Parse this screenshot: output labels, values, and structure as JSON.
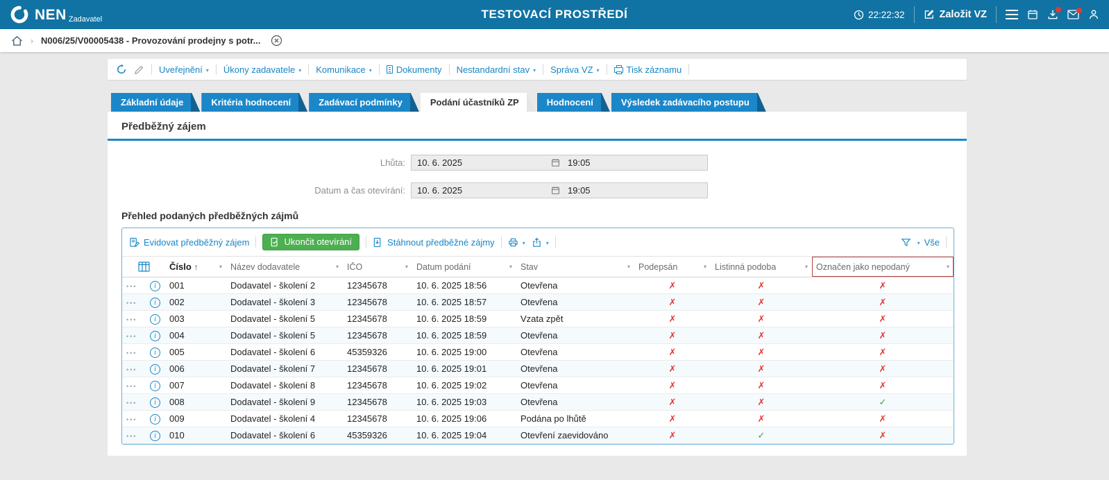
{
  "topbar": {
    "brand": "NEN",
    "brand_subtitle": "Zadavatel",
    "environment_title": "TESTOVACÍ PROSTŘEDÍ",
    "clock": "22:22:32",
    "create_vz_label": "Založit VZ"
  },
  "breadcrumb": {
    "record": "N006/25/V00005438 - Provozování prodejny s potr..."
  },
  "record_menubar": {
    "items": [
      {
        "label": "Uveřejnění",
        "caret": true
      },
      {
        "label": "Úkony zadavatele",
        "caret": true
      },
      {
        "label": "Komunikace",
        "caret": true
      },
      {
        "label": "Dokumenty",
        "icon": "document",
        "caret": false
      },
      {
        "label": "Nestandardní stav",
        "caret": true
      },
      {
        "label": "Správa VZ",
        "caret": true
      },
      {
        "label": "Tisk záznamu",
        "icon": "printer",
        "caret": false
      }
    ]
  },
  "tabs": [
    {
      "label": "Základní údaje",
      "active": false
    },
    {
      "label": "Kritéria hodnocení",
      "active": false
    },
    {
      "label": "Zadávací podmínky",
      "active": false
    },
    {
      "label": "Podání účastníků ZP",
      "active": true
    },
    {
      "label": "Hodnocení",
      "active": false
    },
    {
      "label": "Výsledek zadávacího postupu",
      "active": false
    }
  ],
  "section": {
    "title": "Předběžný zájem"
  },
  "form": {
    "rows": [
      {
        "label": "Lhůta:",
        "date": "10. 6. 2025",
        "time": "19:05"
      },
      {
        "label": "Datum a čas otevírání:",
        "date": "10. 6. 2025",
        "time": "19:05"
      }
    ]
  },
  "table": {
    "title": "Přehled podaných předběžných zájmů",
    "toolbar": {
      "evidovat": "Evidovat předběžný zájem",
      "ukoncit": "Ukončit otevírání",
      "stahnout": "Stáhnout předběžné zájmy",
      "vse": "Vše"
    },
    "columns": [
      {
        "label": "Číslo",
        "sorted": "asc"
      },
      {
        "label": "Název dodavatele"
      },
      {
        "label": "IČO"
      },
      {
        "label": "Datum podání"
      },
      {
        "label": "Stav"
      },
      {
        "label": "Podepsán"
      },
      {
        "label": "Listinná podoba"
      },
      {
        "label": "Označen jako nepodaný",
        "highlighted": true
      }
    ],
    "rows": [
      {
        "cislo": "001",
        "dodavatel": "Dodavatel - školení 2",
        "ico": "12345678",
        "datum": "10. 6. 2025 18:56",
        "stav": "Otevřena",
        "podepsan": false,
        "listinna": false,
        "nepodany": false
      },
      {
        "cislo": "002",
        "dodavatel": "Dodavatel - školení 3",
        "ico": "12345678",
        "datum": "10. 6. 2025 18:57",
        "stav": "Otevřena",
        "podepsan": false,
        "listinna": false,
        "nepodany": false
      },
      {
        "cislo": "003",
        "dodavatel": "Dodavatel - školení 5",
        "ico": "12345678",
        "datum": "10. 6. 2025 18:59",
        "stav": "Vzata zpět",
        "podepsan": false,
        "listinna": false,
        "nepodany": false
      },
      {
        "cislo": "004",
        "dodavatel": "Dodavatel - školení 5",
        "ico": "12345678",
        "datum": "10. 6. 2025 18:59",
        "stav": "Otevřena",
        "podepsan": false,
        "listinna": false,
        "nepodany": false
      },
      {
        "cislo": "005",
        "dodavatel": "Dodavatel - školení 6",
        "ico": "45359326",
        "datum": "10. 6. 2025 19:00",
        "stav": "Otevřena",
        "podepsan": false,
        "listinna": false,
        "nepodany": false
      },
      {
        "cislo": "006",
        "dodavatel": "Dodavatel - školení 7",
        "ico": "12345678",
        "datum": "10. 6. 2025 19:01",
        "stav": "Otevřena",
        "podepsan": false,
        "listinna": false,
        "nepodany": false
      },
      {
        "cislo": "007",
        "dodavatel": "Dodavatel - školení 8",
        "ico": "12345678",
        "datum": "10. 6. 2025 19:02",
        "stav": "Otevřena",
        "podepsan": false,
        "listinna": false,
        "nepodany": false
      },
      {
        "cislo": "008",
        "dodavatel": "Dodavatel - školení 9",
        "ico": "12345678",
        "datum": "10. 6. 2025 19:03",
        "stav": "Otevřena",
        "podepsan": false,
        "listinna": false,
        "nepodany": true
      },
      {
        "cislo": "009",
        "dodavatel": "Dodavatel - školení 4",
        "ico": "12345678",
        "datum": "10. 6. 2025 19:06",
        "stav": "Podána po lhůtě",
        "podepsan": false,
        "listinna": false,
        "nepodany": false
      },
      {
        "cislo": "010",
        "dodavatel": "Dodavatel - školení 6",
        "ico": "45359326",
        "datum": "10. 6. 2025 19:04",
        "stav": "Otevření zaevidováno",
        "podepsan": false,
        "listinna": true,
        "nepodany": false
      }
    ]
  },
  "icons": {
    "caret": "▾",
    "sort_asc": "↑",
    "cross": "✗",
    "check": "✓",
    "row_menu": "•••",
    "info": "i",
    "breadcrumb_chevron": "›"
  },
  "colors": {
    "topbar_blue": "#1173a3",
    "tab_blue": "#1b87c9",
    "link_blue": "#1786c5",
    "button_green": "#4caf50",
    "cross_red": "#e53935",
    "check_green": "#43a047",
    "header_highlight_red": "#b5433c"
  }
}
